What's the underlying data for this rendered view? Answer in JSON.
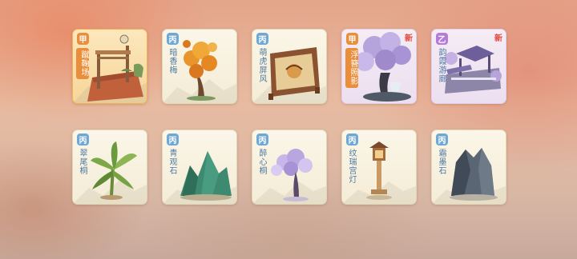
{
  "cards": [
    {
      "grade": "甲",
      "name": "蹴鞠场",
      "is_new": false,
      "selected": true
    },
    {
      "grade": "丙",
      "name": "暗香梅",
      "is_new": false,
      "selected": false
    },
    {
      "grade": "丙",
      "name": "萌虎屏风",
      "is_new": false,
      "selected": false
    },
    {
      "grade": "甲",
      "name": "浮簪照影",
      "is_new": true,
      "selected": false
    },
    {
      "grade": "乙",
      "name": "韵霞游廊",
      "is_new": true,
      "selected": false
    },
    {
      "grade": "丙",
      "name": "翠尾桐",
      "is_new": false,
      "selected": false
    },
    {
      "grade": "丙",
      "name": "青观石",
      "is_new": false,
      "selected": false
    },
    {
      "grade": "丙",
      "name": "醉心桐",
      "is_new": false,
      "selected": false
    },
    {
      "grade": "丙",
      "name": "纹瑞宫灯",
      "is_new": false,
      "selected": false
    },
    {
      "grade": "丙",
      "name": "霜墨石",
      "is_new": false,
      "selected": false
    }
  ],
  "new_label": "新",
  "colors": {
    "grade_jia": "#e98e3a",
    "grade_yi": "#b47cd6",
    "grade_bing": "#6ea8d6",
    "new_badge": "#e5483c"
  }
}
